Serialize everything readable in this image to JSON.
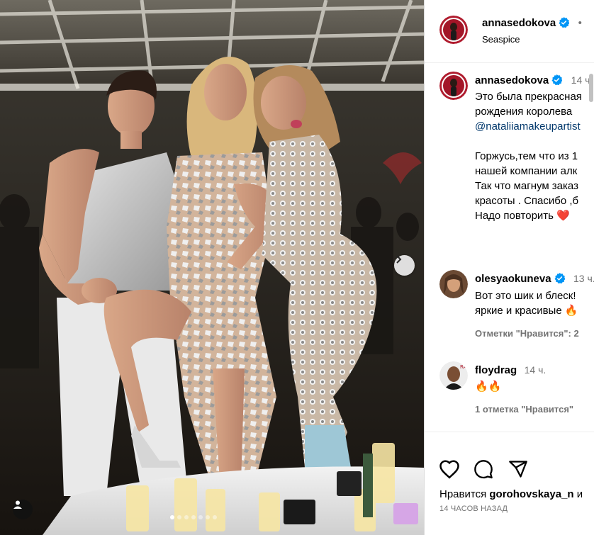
{
  "post": {
    "author": "annasedokova",
    "location": "Seaspice",
    "header_extra": "•",
    "caption_time": "14 ч.",
    "caption_lines": [
      "Это была прекрасная",
      "рождения королева",
      "@nataliiamakeupartist",
      "",
      "Горжусь,тем что из 1",
      "нашей компании алк",
      "Так что магнум заказ",
      "красоты . Спасибо ,б",
      "Надо повторить"
    ],
    "caption_emoji": "❤️"
  },
  "comments": [
    {
      "user": "olesyaokuneva",
      "verified": true,
      "time": "13 ч.",
      "lines": [
        "Вот это шик и блеск!",
        "яркие и красивые 🔥"
      ],
      "likes": "Отметки \"Нравится\": 2"
    },
    {
      "user": "floydrag",
      "verified": false,
      "time": "14 ч.",
      "lines": [
        "🔥🔥"
      ],
      "likes": "1 отметка \"Нравится\""
    }
  ],
  "actions": {
    "liked_by_prefix": "Нравится",
    "liked_by_user": "gorohovskaya_n",
    "liked_by_suffix": "и",
    "timestamp": "14 ЧАСОВ НАЗАД"
  },
  "carousel": {
    "total": 7,
    "active_index": 0
  },
  "icons": {
    "next": "chevron-right-icon",
    "tag": "user-tag-icon",
    "like": "heart-icon",
    "comment": "comment-icon",
    "share": "send-icon",
    "verified": "verified-badge-icon"
  },
  "colors": {
    "verified": "#0095f6",
    "link": "#00376b",
    "muted": "#737373",
    "heart": "#ed4956"
  }
}
